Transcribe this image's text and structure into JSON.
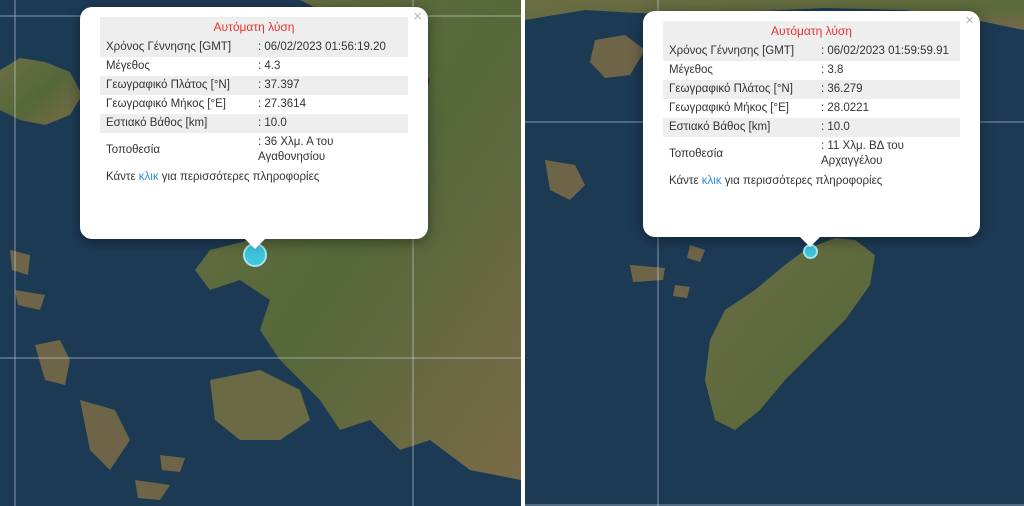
{
  "panels": [
    {
      "popup": {
        "title": "Αυτόματη λύση",
        "rows": [
          {
            "label": "Χρόνος Γέννησης [GMT]",
            "value": ": 06/02/2023 01:56:19.20"
          },
          {
            "label": "Μέγεθος",
            "value": ": 4.3"
          },
          {
            "label": "Γεωγραφικό Πλάτος [°N]",
            "value": ": 37.397"
          },
          {
            "label": "Γεωγραφικό Μήκος [°E]",
            "value": ": 27.3614"
          },
          {
            "label": "Εστιακό Βάθος [km]",
            "value": ": 10.0"
          },
          {
            "label": "Τοποθεσία",
            "value": ": 36 Χλμ. Α του Αγαθονησίου"
          }
        ],
        "more": {
          "prefix": "Κάντε ",
          "link": "κλικ",
          "suffix": " για περισσότερες πληροφορίες"
        },
        "close": "×"
      }
    },
    {
      "popup": {
        "title": "Αυτόματη λύση",
        "rows": [
          {
            "label": "Χρόνος Γέννησης [GMT]",
            "value": ": 06/02/2023 01:59:59.91"
          },
          {
            "label": "Μέγεθος",
            "value": ": 3.8"
          },
          {
            "label": "Γεωγραφικό Πλάτος [°N]",
            "value": ": 36.279"
          },
          {
            "label": "Γεωγραφικό Μήκος [°E]",
            "value": ": 28.0221"
          },
          {
            "label": "Εστιακό Βάθος [km]",
            "value": ": 10.0"
          },
          {
            "label": "Τοποθεσία",
            "value": ": 11 Χλμ. ΒΔ του Αρχαγγέλου"
          }
        ],
        "more": {
          "prefix": "Κάντε ",
          "link": "κλικ",
          "suffix": " για περισσότερες πληροφορίες"
        },
        "close": "×"
      }
    }
  ],
  "colors": {
    "sea": "#1d3a55",
    "land": "#5e6a3a",
    "marker": "#3fc4dc",
    "title": "#e8322c",
    "link": "#2e8be0"
  }
}
